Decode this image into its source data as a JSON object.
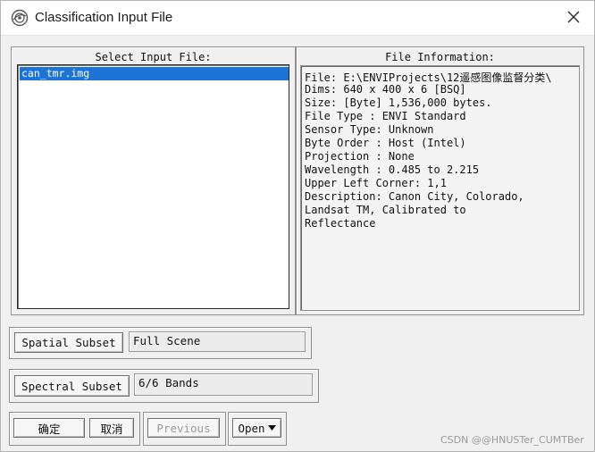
{
  "window": {
    "title": "Classification Input File"
  },
  "input_panel": {
    "title": "Select Input File:",
    "files": [
      "can_tmr.img"
    ]
  },
  "info_panel": {
    "title": "File Information:",
    "lines": [
      "File: E:\\ENVIProjects\\12遥感图像监督分类\\",
      "Dims: 640 x 400 x 6 [BSQ]",
      "Size: [Byte] 1,536,000 bytes.",
      "File Type  : ENVI Standard",
      "Sensor Type: Unknown",
      "Byte Order : Host (Intel)",
      "Projection : None",
      "Wavelength : 0.485 to 2.215",
      "Upper Left Corner: 1,1",
      "Description: Canon City, Colorado,",
      "Landsat TM, Calibrated to",
      "Reflectance"
    ]
  },
  "spatial_subset": {
    "button_label": "Spatial Subset",
    "value": "Full Scene"
  },
  "spectral_subset": {
    "button_label": "Spectral Subset",
    "value": "6/6 Bands"
  },
  "actions": {
    "ok_label": "确定",
    "cancel_label": "取消",
    "previous_label": "Previous",
    "open_label": "Open"
  },
  "watermark": "CSDN @@HNUSTer_CUMTBer",
  "colors": {
    "selection": "#1c73d8",
    "background": "#f0f0f0"
  }
}
